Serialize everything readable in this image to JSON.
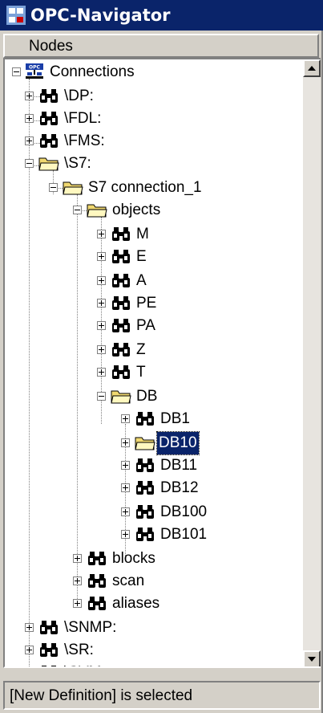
{
  "window": {
    "title": "OPC-Navigator"
  },
  "header": {
    "label": "Nodes"
  },
  "tree": {
    "root": "Connections",
    "dp": "\\DP:",
    "fdl": "\\FDL:",
    "fms": "\\FMS:",
    "s7": "\\S7:",
    "s7conn": "S7 connection_1",
    "objects": "objects",
    "m": "M",
    "e": "E",
    "a": "A",
    "pe": "PE",
    "pa": "PA",
    "z": "Z",
    "t": "T",
    "db": "DB",
    "db1": "DB1",
    "db10": "DB10",
    "db11": "DB11",
    "db12": "DB12",
    "db100": "DB100",
    "db101": "DB101",
    "blocks": "blocks",
    "scan": "scan",
    "aliases": "aliases",
    "snmp": "\\SNMP:",
    "sr": "\\SR:",
    "svm": "\\SVM:"
  },
  "selected_node": "DB10",
  "status": {
    "text": "[New Definition] is selected"
  },
  "colors": {
    "titlebar": "#0a246a",
    "selection": "#0a246a",
    "folder": "#f0d870",
    "window": "#d4d0c8"
  },
  "icons": {
    "connection": "binoculars-icon",
    "folder": "folder-icon",
    "root": "opc-network-icon"
  }
}
